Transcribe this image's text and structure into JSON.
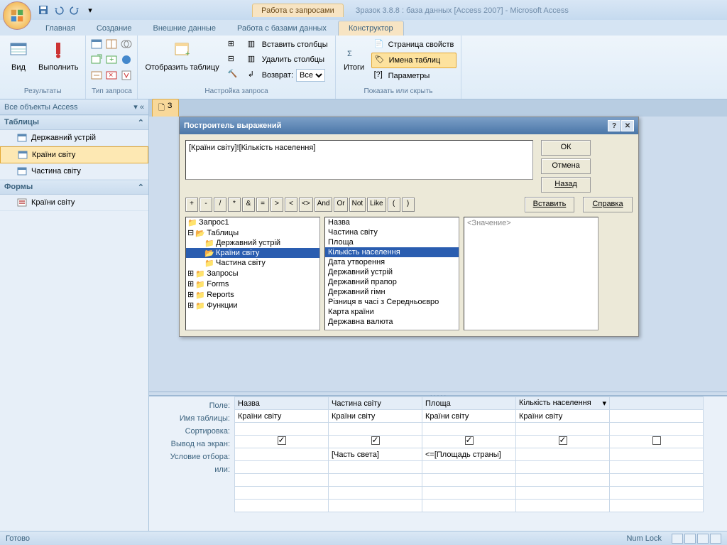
{
  "title": {
    "contextual": "Работа с запросами",
    "text": "Зразок 3.8.8 : база данных [Access 2007] - Microsoft Access"
  },
  "tabs": {
    "home": "Главная",
    "create": "Создание",
    "external": "Внешние данные",
    "dbtools": "Работа с базами данных",
    "design": "Конструктор"
  },
  "ribbon": {
    "view": "Вид",
    "run": "Выполнить",
    "results_grp": "Результаты",
    "qtype_grp": "Тип запроса",
    "showtable": "Отобразить таблицу",
    "insertcols": "Вставить столбцы",
    "deletecols": "Удалить столбцы",
    "return": "Возврат:",
    "return_val": "Все",
    "setup_grp": "Настройка запроса",
    "totals": "Итоги",
    "propsheet": "Страница свойств",
    "tablenames": "Имена таблиц",
    "params": "Параметры",
    "showhide_grp": "Показать или скрыть"
  },
  "nav": {
    "header": "Все объекты Access",
    "tables": "Таблицы",
    "t1": "Державний устрій",
    "t2": "Країни світу",
    "t3": "Частина світу",
    "forms": "Формы",
    "f1": "Країни світу"
  },
  "doc_tab": "З",
  "dlg": {
    "title": "Построитель выражений",
    "expr": "[Країни світу]![Кількість населення]",
    "ok": "ОК",
    "cancel": "Отмена",
    "back": "Назад",
    "insert": "Вставить",
    "help": "Справка",
    "ops": [
      "+",
      "-",
      "/",
      "*",
      "&",
      "=",
      ">",
      "<",
      "<>",
      "And",
      "Or",
      "Not",
      "Like",
      "(",
      ")"
    ],
    "tree": {
      "q1": "Запрос1",
      "tables": "Таблицы",
      "t1": "Державний устрій",
      "t2": "Країни світу",
      "t3": "Частина світу",
      "queries": "Запросы",
      "forms": "Forms",
      "reports": "Reports",
      "funcs": "Функции"
    },
    "fields": [
      "Назва",
      "Частина світу",
      "Площа",
      "Кількість населення",
      "Дата утворення",
      "Державний устрій",
      "Державний прапор",
      "Державний гімн",
      "Різниця в часі з Середньоєвро",
      "Карта країни",
      "Державна валюта"
    ],
    "value_ph": "<Значение>"
  },
  "grid": {
    "labels": {
      "field": "Поле:",
      "table": "Имя таблицы:",
      "sort": "Сортировка:",
      "show": "Вывод на экран:",
      "crit": "Условие отбора:",
      "or": "или:"
    },
    "cols": [
      {
        "field": "Назва",
        "table": "Країни світу",
        "show": true,
        "crit": ""
      },
      {
        "field": "Частина світу",
        "table": "Країни світу",
        "show": true,
        "crit": "[Часть света]"
      },
      {
        "field": "Площа",
        "table": "Країни світу",
        "show": true,
        "crit": "<=[Площадь страны]"
      },
      {
        "field": "Кількість населення",
        "table": "Країни світу",
        "show": true,
        "crit": ""
      },
      {
        "field": "",
        "table": "",
        "show": false,
        "crit": ""
      }
    ]
  },
  "status": {
    "ready": "Готово",
    "numlock": "Num Lock"
  }
}
